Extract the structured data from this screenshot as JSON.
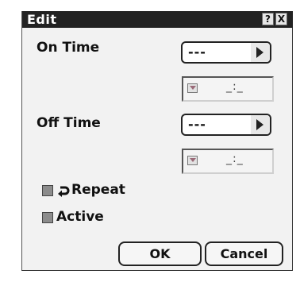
{
  "window": {
    "title": "Edit",
    "help_label": "?",
    "close_label": "X"
  },
  "on_time": {
    "label": "On Time",
    "combo_value": "---",
    "time_value": "_:_"
  },
  "off_time": {
    "label": "Off Time",
    "combo_value": "---",
    "time_value": "_:_"
  },
  "repeat": {
    "label": "Repeat",
    "checked": false
  },
  "active": {
    "label": "Active",
    "checked": false
  },
  "buttons": {
    "ok_label": "OK",
    "cancel_label": "Cancel"
  }
}
